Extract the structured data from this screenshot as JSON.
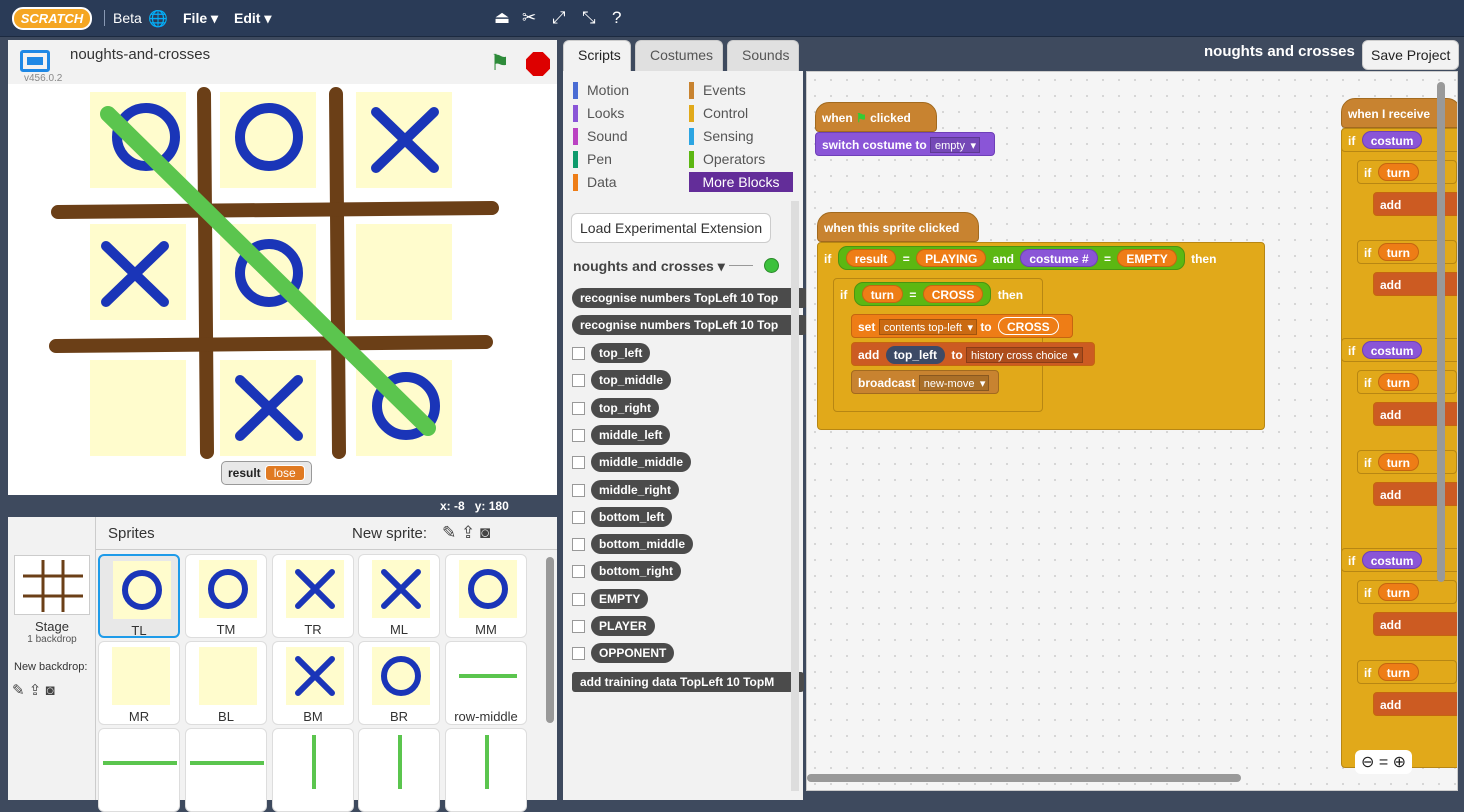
{
  "topbar": {
    "logo": "SCRATCH",
    "beta": "Beta",
    "menus": [
      "File ▾",
      "Edit ▾"
    ]
  },
  "stage": {
    "project_name": "noughts-and-crosses",
    "version": "v456.0.2",
    "monitor_label": "result",
    "monitor_value": "lose",
    "x_label": "x:",
    "x_value": "-8",
    "y_label": "y:",
    "y_value": "180"
  },
  "sprites": {
    "title": "Sprites",
    "new_sprite": "New sprite:",
    "stage_label": "Stage",
    "stage_sub": "1 backdrop",
    "new_backdrop": "New backdrop:",
    "items": [
      {
        "label": "TL",
        "mark": "O"
      },
      {
        "label": "TM",
        "mark": "O"
      },
      {
        "label": "TR",
        "mark": "X"
      },
      {
        "label": "ML",
        "mark": "X"
      },
      {
        "label": "MM",
        "mark": "O"
      },
      {
        "label": "MR",
        "mark": ""
      },
      {
        "label": "BL",
        "mark": ""
      },
      {
        "label": "BM",
        "mark": "X"
      },
      {
        "label": "BR",
        "mark": "O"
      },
      {
        "label": "row-middle",
        "mark": "line"
      }
    ]
  },
  "tabs": [
    "Scripts",
    "Costumes",
    "Sounds"
  ],
  "categories": [
    {
      "name": "Motion",
      "color": "#4a6cd4"
    },
    {
      "name": "Events",
      "color": "#c88330"
    },
    {
      "name": "Looks",
      "color": "#8a55d7"
    },
    {
      "name": "Control",
      "color": "#e1a91a"
    },
    {
      "name": "Sound",
      "color": "#bb42c3"
    },
    {
      "name": "Sensing",
      "color": "#2ca5e2"
    },
    {
      "name": "Pen",
      "color": "#0e9a6c"
    },
    {
      "name": "Operators",
      "color": "#5cb712"
    },
    {
      "name": "Data",
      "color": "#ee7d16"
    },
    {
      "name": "More Blocks",
      "color": "#632d99"
    }
  ],
  "palette": {
    "load_ext": "Load Experimental Extension",
    "ext_name": "noughts and crosses ▾",
    "blocks": [
      "recognise numbers TopLeft 10 Top",
      "recognise numbers TopLeft 10 Top"
    ],
    "reporters": [
      "top_left",
      "top_middle",
      "top_right",
      "middle_left",
      "middle_middle",
      "middle_right",
      "bottom_left",
      "bottom_middle",
      "bottom_right",
      "EMPTY",
      "PLAYER",
      "OPPONENT"
    ],
    "add_block": "add training data TopLeft 10 TopM"
  },
  "header": {
    "project_title": "noughts and crosses",
    "save": "Save Project"
  },
  "scripts": {
    "when": "when",
    "clicked": "clicked",
    "switch": "switch costume to",
    "empty": "empty",
    "when_sprite": "when this sprite clicked",
    "if": "if",
    "result": "result",
    "playing": "PLAYING",
    "and": "and",
    "costume": "costume #",
    "EMPTY": "EMPTY",
    "then": "then",
    "turn": "turn",
    "cross": "CROSS",
    "set": "set",
    "contents": "contents top-left",
    "to": "to",
    "add": "add",
    "top_left": "top_left",
    "history": "history cross choice",
    "broadcast": "broadcast",
    "new_move": "new-move",
    "when_receive": "when I receive",
    "costum": "costum"
  }
}
